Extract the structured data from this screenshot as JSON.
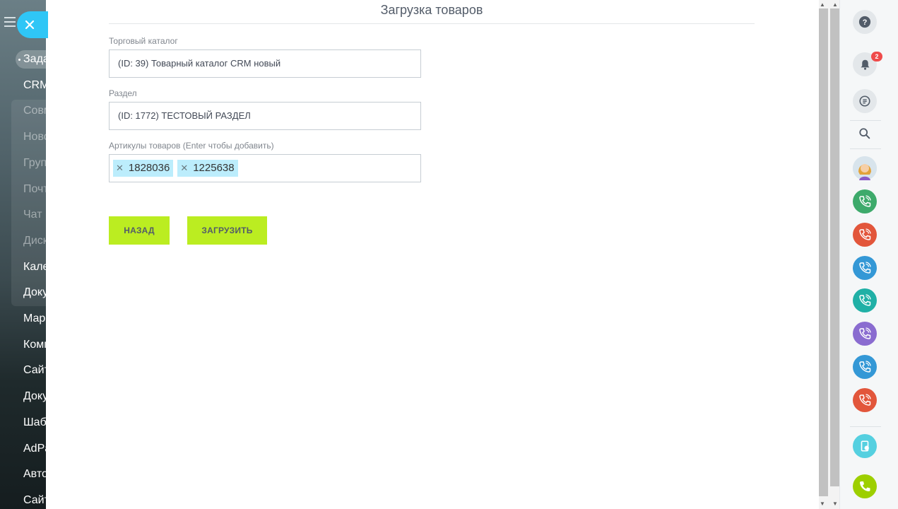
{
  "sidebar": {
    "menu_items": [
      {
        "label": "Задачи и Проекты",
        "active": true,
        "dim": false
      },
      {
        "label": "CRM",
        "active": false,
        "dim": false
      },
      {
        "label": "Совместная работа",
        "active": false,
        "dim": true
      },
      {
        "label": "Новости",
        "active": false,
        "dim": true
      },
      {
        "label": "Группы",
        "active": false,
        "dim": true
      },
      {
        "label": "Почта",
        "active": false,
        "dim": true
      },
      {
        "label": "Чат и звонки",
        "active": false,
        "dim": true
      },
      {
        "label": "Диск",
        "active": false,
        "dim": true
      },
      {
        "label": "Календарь",
        "active": false,
        "dim": false
      },
      {
        "label": "Документы",
        "active": false,
        "dim": false
      },
      {
        "label": "Маркетинг",
        "active": false,
        "dim": false
      },
      {
        "label": "Компания",
        "active": false,
        "dim": false
      },
      {
        "label": "Сайты",
        "active": false,
        "dim": false
      },
      {
        "label": "Документы",
        "active": false,
        "dim": false
      },
      {
        "label": "Шаблоны",
        "active": false,
        "dim": false
      },
      {
        "label": "AdPanel",
        "active": false,
        "dim": false
      },
      {
        "label": "Автоматизация",
        "active": false,
        "dim": false
      },
      {
        "label": "Сайты и магазины",
        "active": false,
        "dim": false
      }
    ]
  },
  "panel": {
    "title": "Загрузка товаров",
    "catalog": {
      "label": "Торговый каталог",
      "value": "(ID: 39) Товарный каталог CRM новый"
    },
    "section": {
      "label": "Раздел",
      "value": "(ID: 1772) ТЕСТОВЫЙ РАЗДЕЛ"
    },
    "articles": {
      "label": "Артикулы товаров (Enter чтобы добавить)",
      "tags": [
        "1828036",
        "1225638"
      ]
    },
    "back_button": "Назад",
    "upload_button": "Загрузить"
  },
  "right_bar": {
    "notification_count": "2",
    "call_colors": [
      "#3daa6b",
      "#e2563b",
      "#3498d6",
      "#20b0a6",
      "#8a6cd0",
      "#3498d6",
      "#e2563b"
    ]
  },
  "colors": {
    "accent_button": "#bbed21",
    "close_button": "#2fc6f6",
    "tag_background": "#bcedfc"
  }
}
